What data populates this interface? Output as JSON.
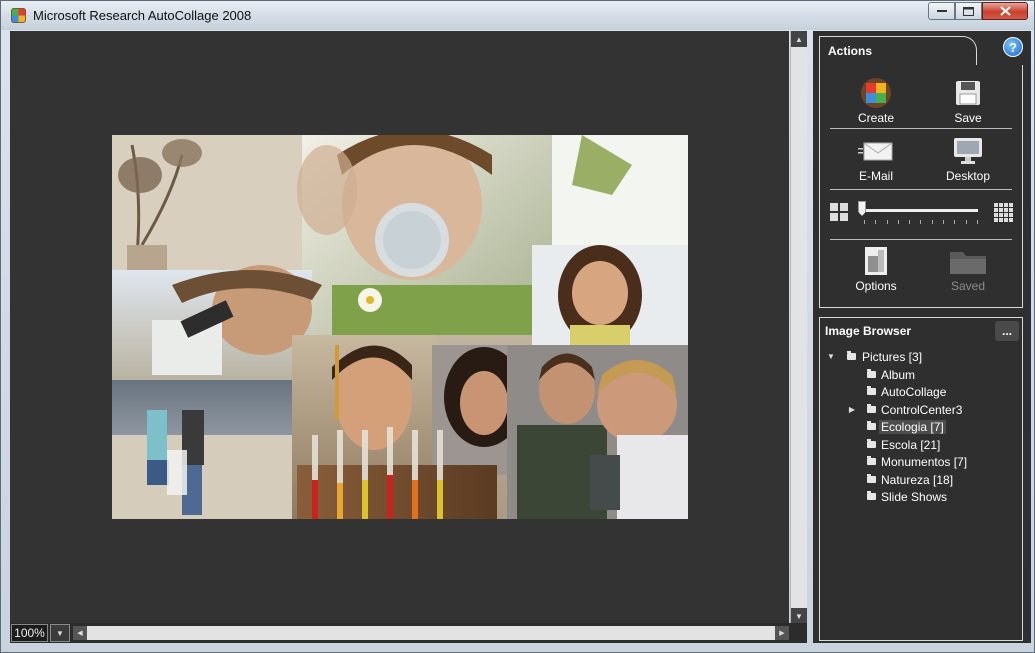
{
  "window": {
    "title": "Microsoft Research AutoCollage 2008"
  },
  "canvas": {
    "zoom": "100%",
    "collage_alt": "Collage of children doing science activities"
  },
  "actions": {
    "title": "Actions",
    "help_label": "?",
    "create": "Create",
    "save": "Save",
    "email": "E-Mail",
    "desktop": "Desktop",
    "options": "Options",
    "saved": "Saved"
  },
  "image_browser": {
    "title": "Image Browser",
    "more_label": "...",
    "tree": [
      {
        "label": "Pictures  [3]",
        "level": 0,
        "expanded": true
      },
      {
        "label": "Album",
        "level": 1
      },
      {
        "label": "AutoCollage",
        "level": 1
      },
      {
        "label": "ControlCenter3",
        "level": 1,
        "collapsed": true
      },
      {
        "label": "Ecologia  [7]",
        "level": 1,
        "selected": true
      },
      {
        "label": "Escola  [21]",
        "level": 1
      },
      {
        "label": "Monumentos  [7]",
        "level": 1
      },
      {
        "label": "Natureza  [18]",
        "level": 1
      },
      {
        "label": "Slide Shows",
        "level": 1
      }
    ]
  },
  "colors": {
    "panel_bg": "#2f2f2f",
    "canvas_bg": "#333333",
    "close_red": "#c8412d"
  }
}
